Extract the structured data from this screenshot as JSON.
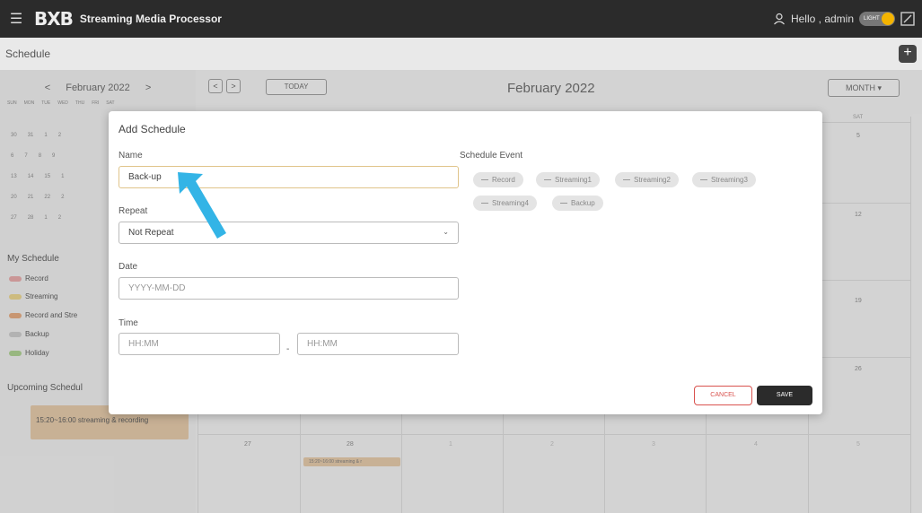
{
  "topbar": {
    "logo": "BXB",
    "app_title": "Streaming Media Processor",
    "greeting": "Hello , admin",
    "theme_toggle": "LIGHT"
  },
  "schedule": {
    "title": "Schedule",
    "add_label": "+"
  },
  "mini_calendar": {
    "month": "February 2022",
    "prev": "<",
    "next": ">",
    "days_of_week": [
      "SUN",
      "MON",
      "TUE",
      "WED",
      "THU",
      "FRI",
      "SAT"
    ],
    "rows": [
      [
        "30",
        "31",
        "1",
        "2"
      ],
      [
        "6",
        "7",
        "8",
        "9"
      ],
      [
        "13",
        "14",
        "15",
        "1"
      ],
      [
        "20",
        "21",
        "22",
        "2"
      ],
      [
        "27",
        "28",
        "1",
        "2"
      ]
    ]
  },
  "my_schedule": {
    "title": "My Schedule",
    "items": [
      {
        "label": "Record",
        "color": "#e6a6a6"
      },
      {
        "label": "Streaming",
        "color": "#e9d48a"
      },
      {
        "label": "Record and Stre",
        "color": "#e3a77a"
      },
      {
        "label": "Backup",
        "color": "#c8c8c8"
      },
      {
        "label": "Holiday",
        "color": "#a9cf8c"
      }
    ]
  },
  "upcoming": {
    "title": "Upcoming Schedul",
    "card": "15:20~16:00  streaming & recording"
  },
  "calendar": {
    "prev": "<",
    "next": ">",
    "today": "TODAY",
    "month": "February 2022",
    "view": "MONTH",
    "sat_header": "SAT",
    "days": {
      "d5": "5",
      "d12": "12",
      "d19": "19",
      "d26": "26",
      "b27": "27",
      "b28": "28",
      "b1": "1",
      "b2": "2",
      "b3": "3",
      "b4": "4",
      "b5": "5"
    },
    "event": "15:20~16:00  streaming & r"
  },
  "dialog": {
    "title": "Add Schedule",
    "name_label": "Name",
    "name_value": "Back-up",
    "repeat_label": "Repeat",
    "repeat_value": "Not Repeat",
    "date_label": "Date",
    "date_placeholder": "YYYY-MM-DD",
    "time_label": "Time",
    "time_start_placeholder": "HH:MM",
    "time_separator": "-",
    "time_end_placeholder": "HH:MM",
    "schedule_event_label": "Schedule Event",
    "events": [
      "Record",
      "Streaming1",
      "Streaming2",
      "Streaming3",
      "Streaming4",
      "Backup"
    ],
    "cancel": "CANCEL",
    "save": "SAVE"
  },
  "colors": {
    "topbar": "#2b2b2b",
    "annotation_arrow": "#33b4e6",
    "cancel": "#d9534f"
  }
}
